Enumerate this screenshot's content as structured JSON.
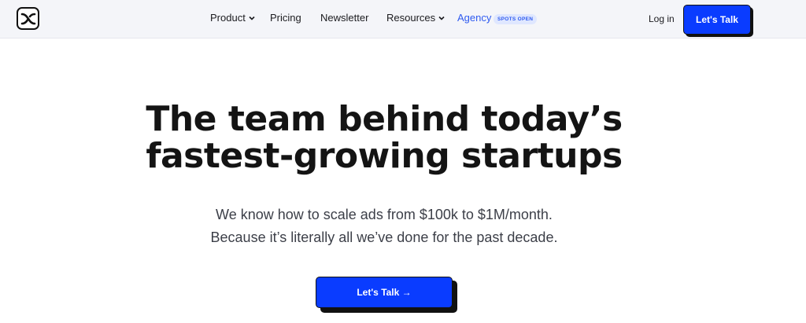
{
  "header": {
    "nav": {
      "product": "Product",
      "pricing": "Pricing",
      "newsletter": "Newsletter",
      "resources": "Resources",
      "agency": "Agency",
      "agency_badge": "SPOTS OPEN"
    },
    "login": "Log in",
    "cta": "Let's Talk"
  },
  "hero": {
    "title_line1": "The team behind today’s",
    "title_line2": "fastest-growing startups",
    "subtitle_line1": "We know how to scale ads from $100k to $1M/month.",
    "subtitle_line2": "Because it’s literally all we’ve done for the past decade.",
    "cta": "Let's Talk →"
  },
  "colors": {
    "accent": "#0a3cff",
    "agency_link": "#2f5bf0",
    "header_bg": "#f4f5f9"
  },
  "icons": {
    "logo": "logo-icon",
    "dropdown": "chevron-down-icon"
  }
}
